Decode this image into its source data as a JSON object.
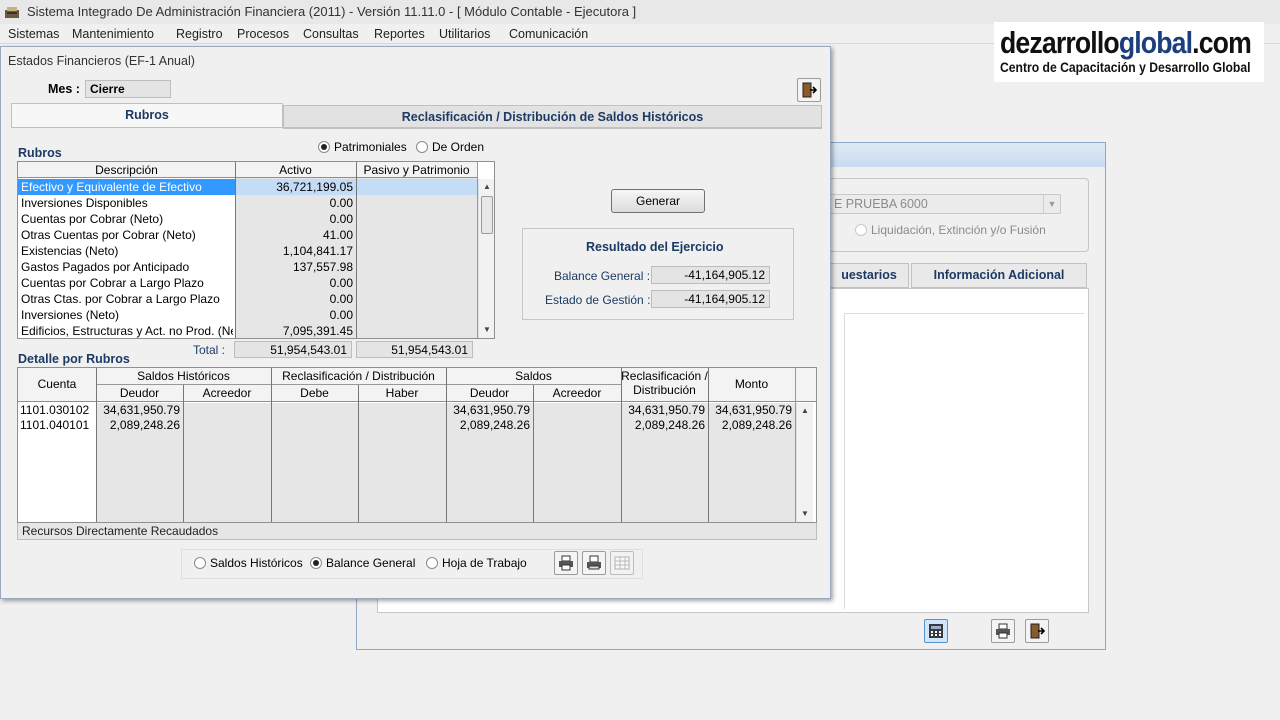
{
  "app": {
    "title": "Sistema Integrado De Administración Financiera (2011) - Versión 11.11.0 - [ Módulo Contable - Ejecutora ]"
  },
  "menu": [
    "Sistemas",
    "Mantenimiento",
    "Registro",
    "Procesos",
    "Consultas",
    "Reportes",
    "Utilitarios",
    "Comunicación"
  ],
  "brand": {
    "name_part1": "dezarrollo",
    "name_part2": "global",
    "name_part3": ".com",
    "tagline": "Centro de Capacitación y Desarrollo Global"
  },
  "back_window": {
    "combo_value": "E PRUEBA 6000",
    "radio_label": "Liquidación, Extinción y/o Fusión",
    "tab1": "uestarios",
    "tab2": "Información Adicional"
  },
  "dialog": {
    "title": "Estados Financieros (EF-1 Anual)",
    "mes_label": "Mes :",
    "mes_value": "Cierre",
    "tabs": [
      "Rubros",
      "Reclasificación / Distribución de Saldos Históricos"
    ],
    "radio_patrimoniales": "Patrimoniales",
    "radio_de_orden": "De Orden",
    "rubros_label": "Rubros",
    "rubros_headers": [
      "Descripción",
      "Activo",
      "Pasivo y Patrimonio"
    ],
    "rubros_rows": [
      {
        "desc": "Efectivo y Equivalente de Efectivo",
        "activo": "36,721,199.05",
        "pasivo": ""
      },
      {
        "desc": "Inversiones Disponibles",
        "activo": "0.00",
        "pasivo": ""
      },
      {
        "desc": "Cuentas por Cobrar (Neto)",
        "activo": "0.00",
        "pasivo": ""
      },
      {
        "desc": "Otras Cuentas por Cobrar (Neto)",
        "activo": "41.00",
        "pasivo": ""
      },
      {
        "desc": "Existencias (Neto)",
        "activo": "1,104,841.17",
        "pasivo": ""
      },
      {
        "desc": "Gastos Pagados por Anticipado",
        "activo": "137,557.98",
        "pasivo": ""
      },
      {
        "desc": "Cuentas por Cobrar a Largo Plazo",
        "activo": "0.00",
        "pasivo": ""
      },
      {
        "desc": "Otras Ctas. por Cobrar a Largo Plazo",
        "activo": "0.00",
        "pasivo": ""
      },
      {
        "desc": "Inversiones (Neto)",
        "activo": "0.00",
        "pasivo": ""
      },
      {
        "desc": "Edificios, Estructuras y Act. no Prod. (Neto",
        "activo": "7,095,391.45",
        "pasivo": ""
      }
    ],
    "total_label": "Total :",
    "total_activo": "51,954,543.01",
    "total_pasivo": "51,954,543.01",
    "generar_label": "Generar",
    "resultado": {
      "title": "Resultado del Ejercicio",
      "balance_label": "Balance General :",
      "balance_value": "-41,164,905.12",
      "gestion_label": "Estado de Gestión :",
      "gestion_value": "-41,164,905.12"
    },
    "detalle_label": "Detalle por Rubros",
    "detalle_headers": {
      "cuenta": "Cuenta",
      "saldos_historicos": "Saldos Históricos",
      "reclasif": "Reclasificación / Distribución",
      "saldos": "Saldos",
      "reclasif_dist_1": "Reclasificación /",
      "reclasif_dist_2": "Distribución",
      "monto": "Monto",
      "deudor": "Deudor",
      "acreedor": "Acreedor",
      "debe": "Debe",
      "haber": "Haber"
    },
    "detalle_rows": [
      {
        "cuenta": "1101.030102",
        "sh_deudor": "34,631,950.79",
        "sh_acreedor": "",
        "debe": "",
        "haber": "",
        "s_deudor": "34,631,950.79",
        "s_acreedor": "",
        "reclas": "34,631,950.79",
        "monto": "34,631,950.79"
      },
      {
        "cuenta": "1101.040101",
        "sh_deudor": "2,089,248.26",
        "sh_acreedor": "",
        "debe": "",
        "haber": "",
        "s_deudor": "2,089,248.26",
        "s_acreedor": "",
        "reclas": "2,089,248.26",
        "monto": "2,089,248.26"
      }
    ],
    "footer_text": "Recursos Directamente Recaudados",
    "bottom_radios": [
      "Saldos Históricos",
      "Balance General",
      "Hoja de Trabajo"
    ],
    "bottom_radio_selected": "Balance General"
  },
  "colors": {
    "selection": "#3399ff",
    "navy_text": "#1c3a63",
    "brand_blue": "#1c3e7c"
  },
  "icons": [
    "app-icon",
    "exit-icon",
    "printer-icon",
    "print-preview-icon",
    "grid-icon",
    "calculator-icon",
    "scroll-up-icon",
    "scroll-down-icon"
  ]
}
